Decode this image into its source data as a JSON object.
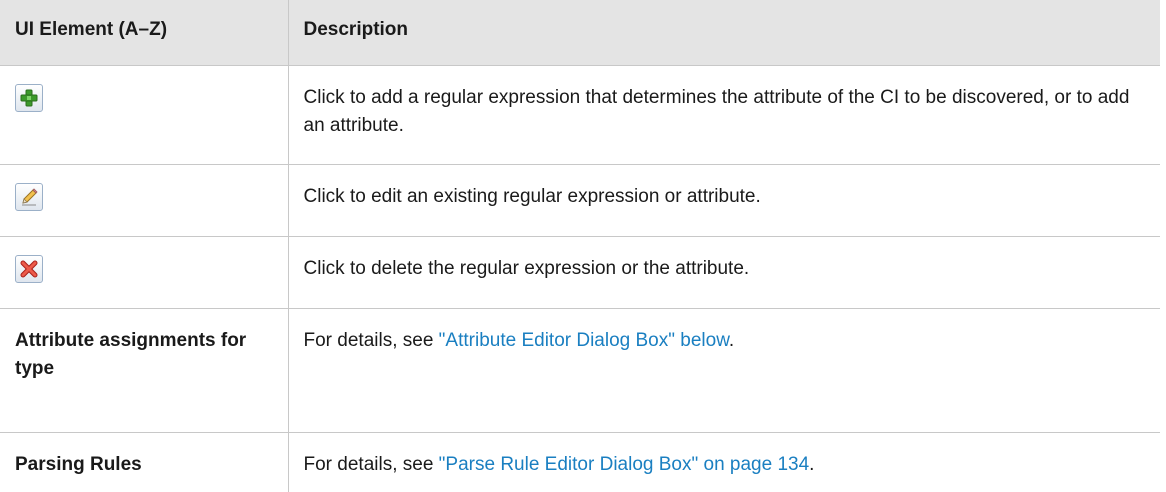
{
  "headers": {
    "element": "UI Element (A–Z)",
    "description": "Description"
  },
  "rows": {
    "add": {
      "icon": "add-icon",
      "description": "Click to add a regular expression that determines the attribute of the CI to be discovered, or to add an attribute."
    },
    "edit": {
      "icon": "edit-pencil-icon",
      "description": "Click to edit an existing regular expression or attribute."
    },
    "delete": {
      "icon": "delete-icon",
      "description": "Click to delete the regular expression or the attribute."
    },
    "attribute_assignments": {
      "name": "Attribute assignments for type",
      "prefix": "For details, see ",
      "link": "\"Attribute Editor Dialog Box\" below",
      "suffix": "."
    },
    "parsing_rules": {
      "name": "Parsing Rules",
      "prefix": "For details, see ",
      "link": "\"Parse Rule Editor Dialog Box\" on page 134",
      "suffix": "."
    }
  },
  "colors": {
    "link": "#1a7fc1",
    "header_bg": "#e4e4e4",
    "border": "#c8c8c8"
  }
}
